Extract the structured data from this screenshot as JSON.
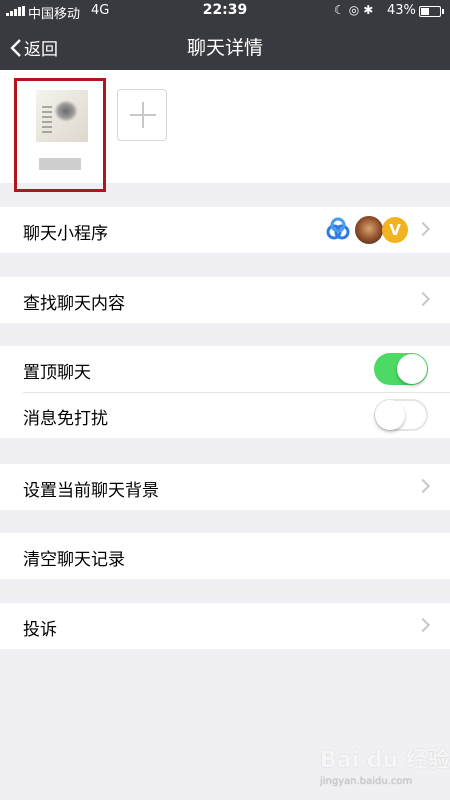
{
  "status_bar": {
    "carrier": "中国移动",
    "network": "4G",
    "time": "22:39",
    "battery_pct": "43%",
    "battery_level": 0.43
  },
  "nav": {
    "back_label": "返回",
    "title": "聊天详情"
  },
  "members": {
    "add_button_icon": "plus-icon"
  },
  "cells": {
    "mini_programs": "聊天小程序",
    "search_history": "查找聊天内容",
    "sticky_chat": "置顶聊天",
    "sticky_chat_on": true,
    "mute_notifications": "消息免打扰",
    "mute_notifications_on": false,
    "set_background": "设置当前聊天背景",
    "clear_history": "清空聊天记录",
    "report": "投诉"
  },
  "mini_program_icons": [
    "flower-app-icon",
    "hero-avatar-icon",
    "v-badge-icon"
  ],
  "mini_program_v_letter": "V",
  "watermark": {
    "brand": "Bai du 经验",
    "url": "jingyan.baidu.com"
  },
  "colors": {
    "nav_bg": "#393a3f",
    "toggle_on": "#4cd964",
    "highlight_border": "#b0161b",
    "page_bg": "#efeff4"
  }
}
